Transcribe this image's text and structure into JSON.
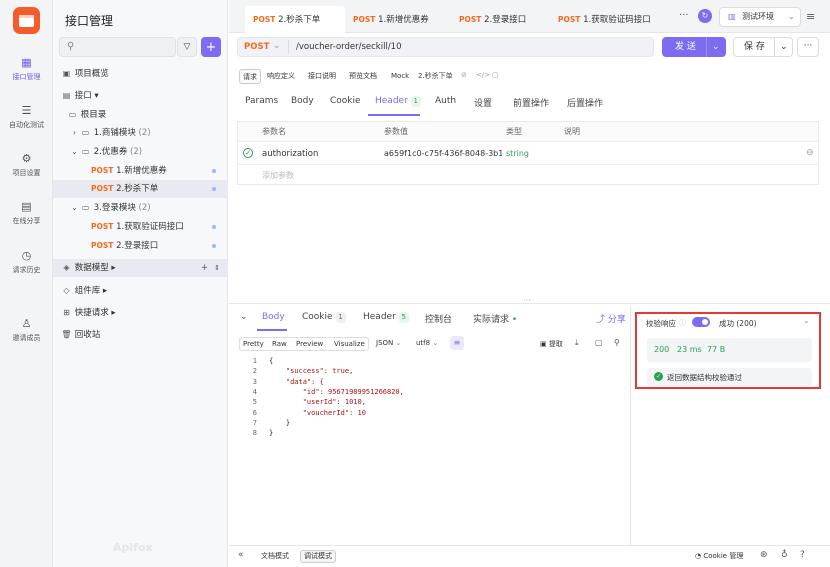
{
  "nav": {
    "items": [
      {
        "label": "接口管理",
        "icon": "api-management-icon",
        "active": true
      },
      {
        "label": "自动化测试",
        "icon": "automation-icon"
      },
      {
        "label": "项目设置",
        "icon": "settings-icon"
      },
      {
        "label": "在线分享",
        "icon": "share-icon"
      },
      {
        "label": "请求历史",
        "icon": "history-icon"
      },
      {
        "label": "邀请成员",
        "icon": "invite-icon"
      }
    ]
  },
  "sidebar": {
    "title": "接口管理",
    "overview": "项目概览",
    "interfaces": "接口 ▾",
    "root": "根目录",
    "folders": [
      {
        "label": "1.商铺模块",
        "count": "(2)"
      },
      {
        "label": "2.优惠券",
        "count": "(2)"
      },
      {
        "label": "3.登录模块",
        "count": "(2)"
      }
    ],
    "endpoints": [
      {
        "method": "POST",
        "label": "1.新增优惠券"
      },
      {
        "method": "POST",
        "label": "2.秒杀下单"
      },
      {
        "method": "POST",
        "label": "1.获取验证码接口"
      },
      {
        "method": "POST",
        "label": "2.登录接口"
      }
    ],
    "data_models": "数据模型 ▸",
    "components": "组件库 ▸",
    "quick_requests": "快捷请求 ▸",
    "recycle": "回收站",
    "watermark": "Apifox"
  },
  "tabs": [
    {
      "method": "POST",
      "label": "2.秒杀下单"
    },
    {
      "method": "POST",
      "label": "1.新增优惠券"
    },
    {
      "method": "POST",
      "label": "2.登录接口"
    },
    {
      "method": "POST",
      "label": "1.获取验证码接口"
    }
  ],
  "env": "测试环境",
  "request": {
    "method": "POST",
    "url": "/voucher-order/seckill/10",
    "send": "发 送",
    "save": "保 存",
    "subtabs": [
      "请求",
      "响应定义",
      "接口说明",
      "预览文档",
      "Mock"
    ],
    "crumb": "2.秒杀下单",
    "param_tabs": [
      "Params",
      "Body",
      "Cookie",
      "Header",
      "Auth",
      "设置",
      "前置操作",
      "后置操作"
    ],
    "header_count": "1",
    "table": {
      "headers": [
        "参数名",
        "参数值",
        "类型",
        "说明"
      ],
      "row": {
        "name": "authorization",
        "value": "a659f1c0-c75f-436f-8048-3b1",
        "type": "string"
      },
      "add_placeholder": "添加参数"
    }
  },
  "response": {
    "tabs": [
      "Body",
      "Cookie",
      "Header",
      "控制台",
      "实际请求"
    ],
    "cookie_count": "1",
    "header_count": "5",
    "share": "分享",
    "view_tabs": [
      "Pretty",
      "Raw",
      "Preview",
      "Visualize"
    ],
    "format": "JSON",
    "encoding": "utf8",
    "extract": "提取",
    "code_lines": [
      "{",
      "    \"success\": true,",
      "    \"data\": {",
      "        \"id\": 95671989951266820,",
      "        \"userId\": 1010,",
      "        \"voucherId\": 10",
      "    }",
      "}"
    ]
  },
  "validation": {
    "label": "校验响应",
    "result": "成功 (200)",
    "status": "200",
    "time": "23 ms",
    "size": "77 B",
    "passed": "返回数据结构校验通过"
  },
  "statusbar": {
    "doc_mode": "文档模式",
    "debug_mode": "调试模式",
    "cookie": "Cookie 管理"
  }
}
